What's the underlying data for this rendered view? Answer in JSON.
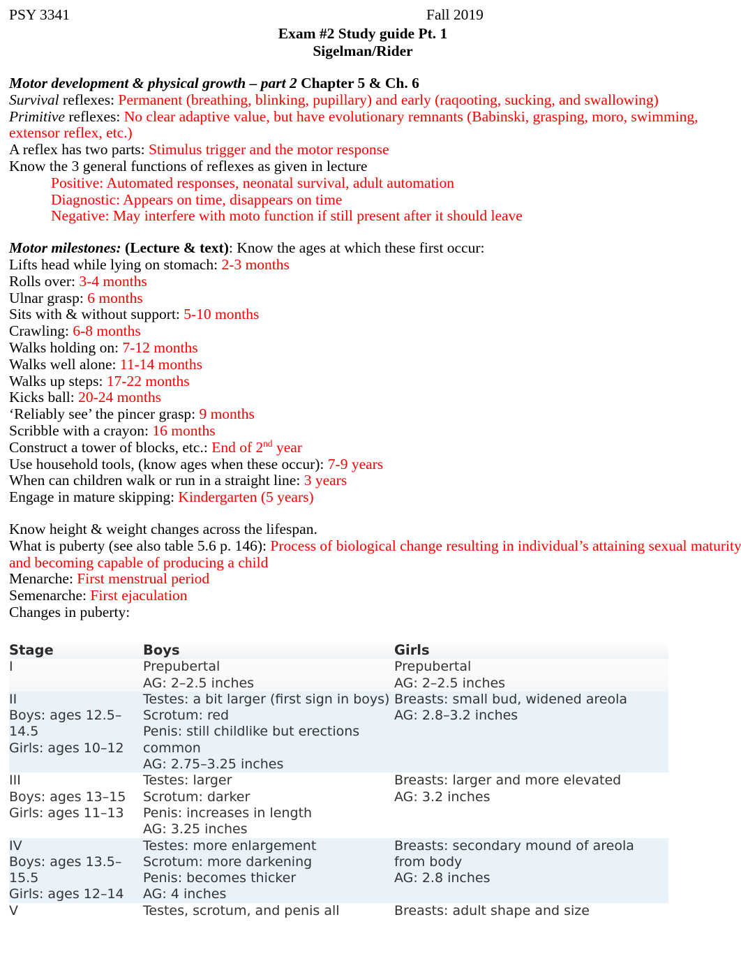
{
  "header": {
    "course_code": "PSY 3341",
    "term": "Fall 2019"
  },
  "title": {
    "line1": "Exam #2 Study guide Pt. 1",
    "line2": "Sigelman/Rider"
  },
  "sections": {
    "motor_dev": {
      "heading_italic": "Motor development & physical growth – part 2",
      "heading_rest": " Chapter 5 & Ch. 6",
      "survival_label_italic": "Survival",
      "survival_label_rest": " reflexes: ",
      "survival_answer": "Permanent (breathing, blinking, pupillary) and early (raqooting, sucking, and swallowing)",
      "primitive_label_italic": "Primitive",
      "primitive_label_rest": " reflexes: ",
      "primitive_answer": "No clear adaptive value, but have evolutionary remnants (Babinski, grasping, moro, swimming, extensor reflex, etc.)",
      "two_parts_label": "A reflex has two parts: ",
      "two_parts_answer": "Stimulus trigger and the motor response",
      "three_functions_label": "Know the 3 general functions of reflexes as given in lecture",
      "function_positive": "Positive: Automated responses, neonatal survival, adult automation",
      "function_diagnostic": "Diagnostic: Appears on time, disappears on time",
      "function_negative": "Negative: May interfere with moto function if still present after it should leave"
    },
    "milestones": {
      "heading_italic": "Motor milestones:",
      "heading_bold": " (Lecture & text)",
      "heading_rest": ": Know the ages at which these first occur:",
      "items": [
        {
          "label": "Lifts head while lying on stomach: ",
          "answer": "2-3 months"
        },
        {
          "label": "Rolls over: ",
          "answer": "3-4 months"
        },
        {
          "label": "Ulnar grasp: ",
          "answer": "6 months"
        },
        {
          "label": "Sits with & without support: ",
          "answer": "5-10 months"
        },
        {
          "label": "Crawling: ",
          "answer": "6-8 months"
        },
        {
          "label": "Walks holding on: ",
          "answer": "7-12 months"
        },
        {
          "label": "Walks well alone: ",
          "answer": "11-14 months"
        },
        {
          "label": "Walks up steps: ",
          "answer": "17-22 months"
        },
        {
          "label": "Kicks ball: ",
          "answer": "20-24 months"
        },
        {
          "label": "‘Reliably see’ the pincer grasp: ",
          "answer": "9 months"
        },
        {
          "label": "Scribble with a crayon: ",
          "answer": "16 months"
        },
        {
          "label": "Construct a tower of blocks, etc.: ",
          "answer": "End of 2",
          "answer_sup": "nd",
          "answer_tail": " year"
        },
        {
          "label": "Use household tools, (know ages when these occur): ",
          "answer": "7-9 years"
        },
        {
          "label": "When can children walk or run in a straight line: ",
          "answer": "3 years"
        },
        {
          "label": "Engage in mature skipping: ",
          "answer": "Kindergarten (5 years)"
        }
      ]
    },
    "puberty": {
      "height_weight_line": "Know height & weight changes across the lifespan.",
      "what_is_label": "What is puberty (see also table 5.6 p. 146): ",
      "what_is_answer": "Process of biological change resulting in individual’s attaining sexual maturity and becoming capable of producing a child",
      "menarche_label": "Menarche: ",
      "menarche_answer": "First menstrual period",
      "semenarche_label": "Semenarche: ",
      "semenarche_answer": "First ejaculation",
      "changes_label": "Changes in puberty:"
    }
  },
  "puberty_table": {
    "columns": [
      "Stage",
      "Boys",
      "Girls"
    ],
    "rows": [
      {
        "stage": "I",
        "boys": "Prepubertal\nAG: 2–2.5 inches",
        "girls": "Prepubertal\nAG: 2–2.5 inches"
      },
      {
        "stage": "II\nBoys: ages 12.5–14.5\nGirls: ages 10–12",
        "boys": "Testes: a bit larger (first sign in boys)\nScrotum: red\nPenis: still childlike but erections common\nAG: 2.75–3.25 inches",
        "girls": "Breasts: small bud, widened areola\nAG: 2.8–3.2 inches"
      },
      {
        "stage": "III\nBoys: ages 13–15\nGirls: ages 11–13",
        "boys": "Testes: larger\nScrotum: darker\nPenis: increases in length\nAG: 3.25 inches",
        "girls": "Breasts: larger and more elevated\nAG: 3.2 inches"
      },
      {
        "stage": "IV\nBoys: ages 13.5–15.5\nGirls: ages 12–14",
        "boys": "Testes: more enlargement\nScrotum: more darkening\nPenis: becomes thicker\nAG: 4 inches",
        "girls": "Breasts: secondary mound of areola from body\nAG: 2.8 inches"
      },
      {
        "stage": "V",
        "boys": "Testes, scrotum, and penis all",
        "girls": "Breasts: adult shape and size"
      }
    ]
  },
  "colors": {
    "answer_red": "#ff0000",
    "text_black": "#000000",
    "table_text": "#333333",
    "row_shade_blue": "#e9f1f9",
    "row_shade_grey": "#f5f7f9"
  }
}
